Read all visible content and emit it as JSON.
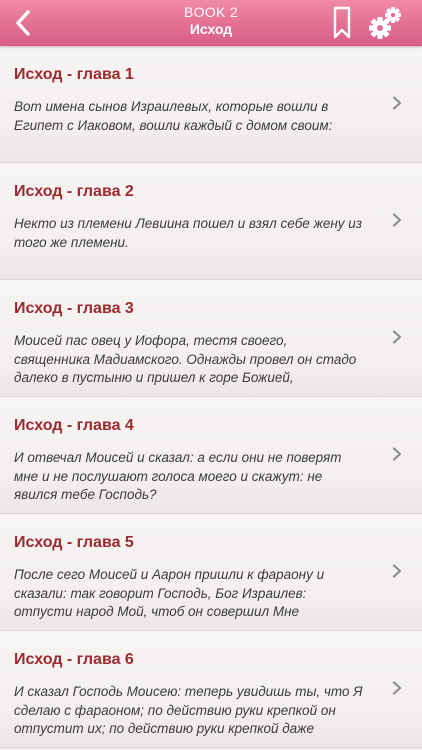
{
  "header": {
    "book_label": "BOOK 2",
    "title": "Исход",
    "back_icon": "chevron-left-icon",
    "bookmark_icon": "bookmark-icon",
    "settings_icon": "gear-icon"
  },
  "colors": {
    "header": "#e36f93",
    "title_text": "#9e2a2d",
    "body_text": "#3c3c3c",
    "background": "#f2eeee"
  },
  "chapters": [
    {
      "title": "Исход - глава 1",
      "text": "Вот имена сынов Израилевых, которые вошли в Египет с Иаковом, вошли каждый с домом своим:"
    },
    {
      "title": "Исход - глава 2",
      "text": "Некто из племени Левиина пошел и взял себе жену из того же племени."
    },
    {
      "title": "Исход - глава 3",
      "text": "Моисей пас овец у Иофора, тестя своего, священника Мадиамского. Однажды провел он стадо далеко в пустыню и пришел к горе Божией,"
    },
    {
      "title": "Исход - глава 4",
      "text": "И отвечал Моисей и сказал: а если они не поверят мне и не послушают голоса моего и скажут: не явился тебе Господь?"
    },
    {
      "title": "Исход - глава 5",
      "text": "После сего Моисей и Аарон пришли к фараону и сказали: так говорит Господь, Бог Израилев: отпусти народ Мой, чтоб он совершил Мне"
    },
    {
      "title": "Исход - глава 6",
      "text": "И сказал Господь Моисею: теперь увидишь ты, что Я сделаю с фараоном; по действию руки крепкой он отпустит их; по действию руки крепкой даже"
    }
  ]
}
